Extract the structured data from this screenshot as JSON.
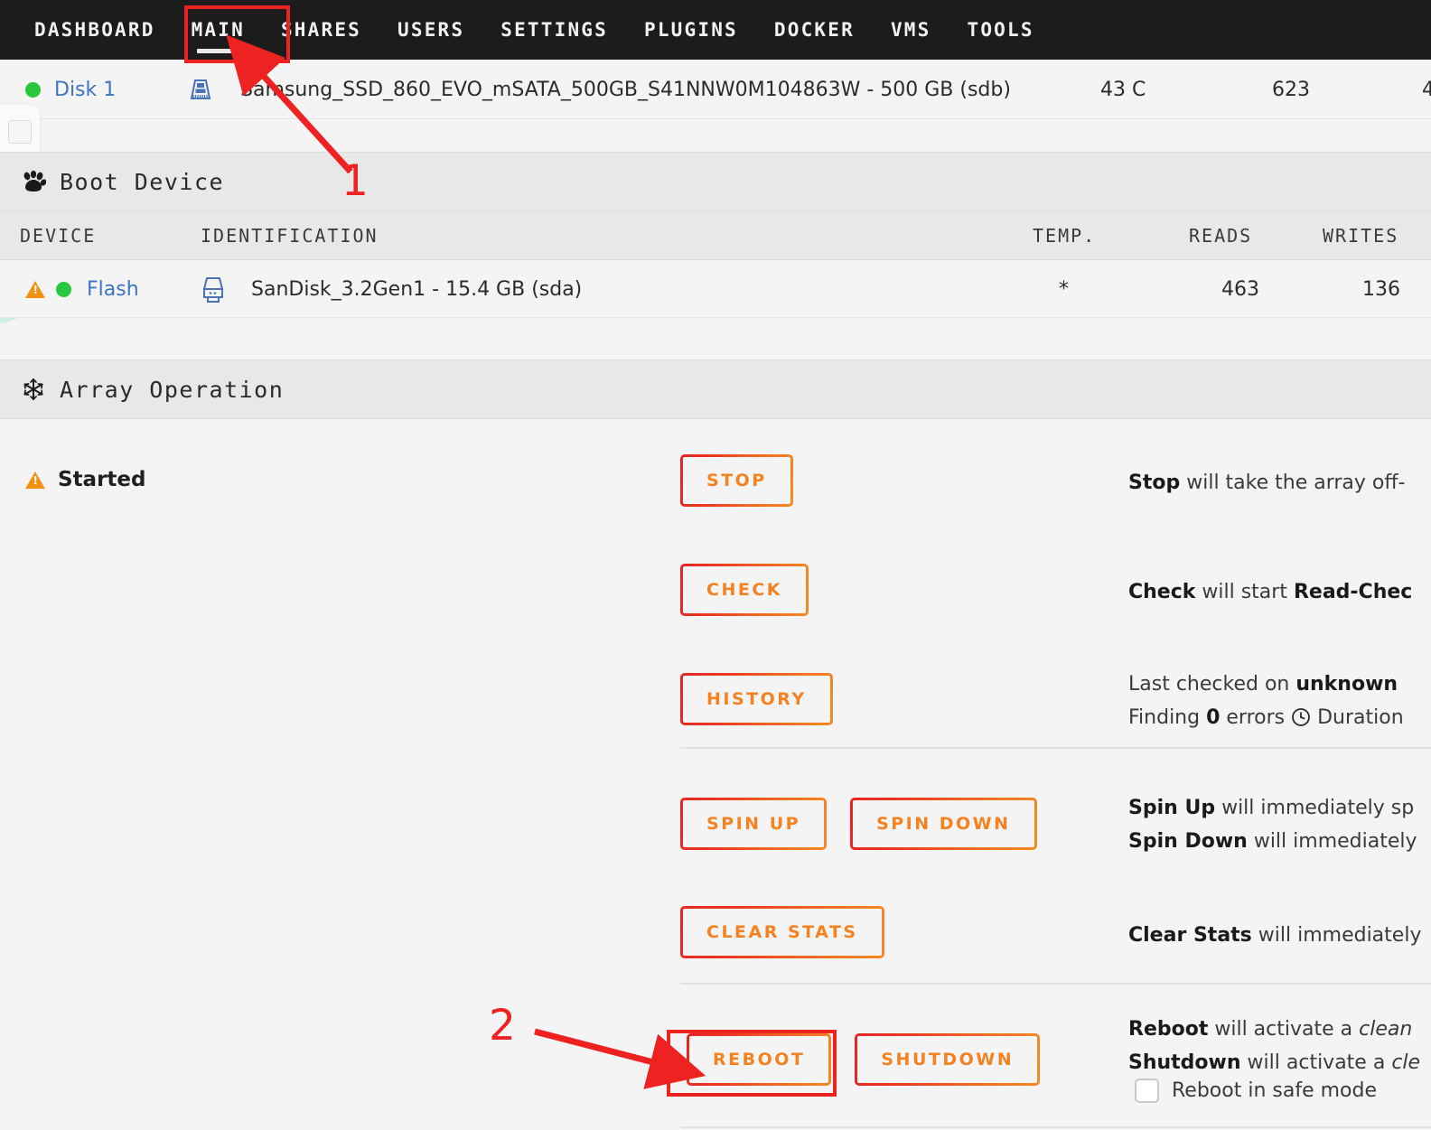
{
  "nav": {
    "items": [
      {
        "label": "DASHBOARD",
        "active": false
      },
      {
        "label": "MAIN",
        "active": true
      },
      {
        "label": "SHARES",
        "active": false
      },
      {
        "label": "USERS",
        "active": false
      },
      {
        "label": "SETTINGS",
        "active": false
      },
      {
        "label": "PLUGINS",
        "active": false
      },
      {
        "label": "DOCKER",
        "active": false
      },
      {
        "label": "VMS",
        "active": false
      },
      {
        "label": "TOOLS",
        "active": false
      }
    ]
  },
  "disk_row": {
    "name": "Disk 1",
    "icon": "ssd-icon",
    "status_color": "#28c83c",
    "identification": "Samsung_SSD_860_EVO_mSATA_500GB_S41NNW0M104863W - 500 GB (sdb)",
    "temp": "43 C",
    "reads": "623",
    "writes_partial": "4"
  },
  "boot_section": {
    "title": "Boot Device",
    "icon": "paw-icon",
    "columns": [
      "DEVICE",
      "IDENTIFICATION",
      "TEMP.",
      "READS",
      "WRITES"
    ],
    "row": {
      "warning_icon": "warning-triangle-icon",
      "status_color": "#28c83c",
      "device": "Flash",
      "icon": "usb-flash-icon",
      "identification": "SanDisk_3.2Gen1 - 15.4 GB (sda)",
      "temp": "*",
      "reads": "463",
      "writes": "136"
    }
  },
  "array_section": {
    "title": "Array Operation",
    "icon": "snowflake-icon",
    "status": "Started",
    "status_icon": "warning-triangle-icon",
    "buttons": {
      "stop": "STOP",
      "check": "CHECK",
      "history": "HISTORY",
      "spin_up": "SPIN UP",
      "spin_down": "SPIN DOWN",
      "clear_stats": "CLEAR STATS",
      "reboot": "REBOOT",
      "shutdown": "SHUTDOWN"
    },
    "descriptions": {
      "stop_bold": "Stop",
      "stop_rest": " will take the array off-",
      "check_bold": "Check",
      "check_mid": " will start ",
      "check_bold2": "Read-Chec",
      "history_line1_pre": "Last checked on ",
      "history_line1_bold": "unknown",
      "history_line2_pre": "Finding ",
      "history_line2_bold": "0",
      "history_line2_mid": " errors ",
      "history_line2_icon": "clock-icon",
      "history_line2_post": " Duration",
      "spin_up_bold": "Spin Up",
      "spin_up_rest": " will immediately sp",
      "spin_down_bold": "Spin Down",
      "spin_down_rest": " will immediately",
      "clear_stats_bold": "Clear Stats",
      "clear_stats_rest": " will immediately",
      "reboot_bold": "Reboot",
      "reboot_mid": " will activate a ",
      "reboot_italic": "clean",
      "shutdown_bold": "Shutdown",
      "shutdown_mid": " will activate a ",
      "shutdown_italic": "cle"
    },
    "safe_mode_label": "Reboot in safe mode",
    "safe_mode_checked": false
  },
  "annotations": {
    "marker_1": "1",
    "marker_2": "2",
    "color": "#ef2222"
  },
  "colors": {
    "accent_orange": "#f58220",
    "accent_red": "#e62525",
    "nav_bg": "#1c1c1c",
    "page_bg": "#f4f4f4",
    "link_blue": "#3f74c4",
    "status_green": "#28c83c",
    "warning_orange": "#f29111"
  }
}
